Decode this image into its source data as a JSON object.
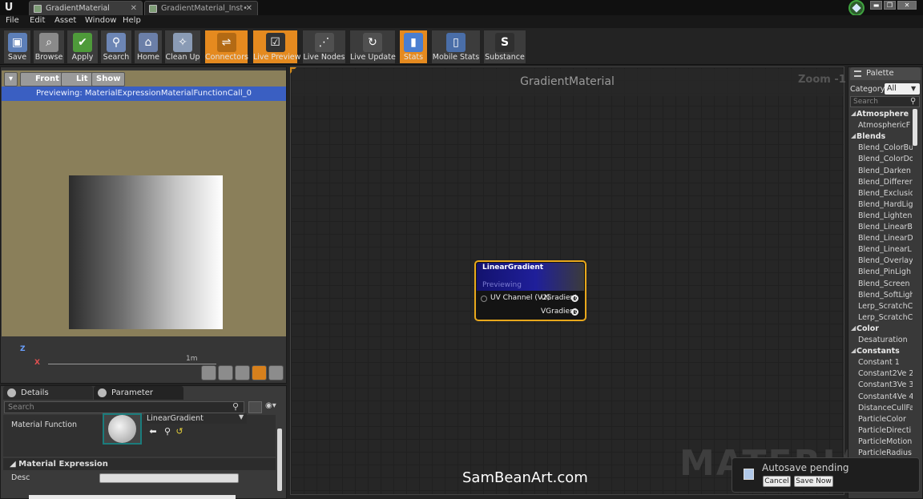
{
  "tabs": [
    {
      "label": "GradientMaterial",
      "close": "✕"
    },
    {
      "label": "GradientMaterial_Inst•",
      "close": "✕"
    }
  ],
  "window": {
    "minimize": "▬",
    "maximize": "❐",
    "close": "✕"
  },
  "menu": [
    "File",
    "Edit",
    "Asset",
    "Window",
    "Help"
  ],
  "toolbar": [
    {
      "label": "Save",
      "icon": "save-icon",
      "glyph": "▣"
    },
    {
      "label": "Browse",
      "icon": "browse-icon",
      "glyph": "⌕"
    },
    {
      "label": "Apply",
      "icon": "apply-icon",
      "glyph": "✔"
    },
    {
      "label": "Search",
      "icon": "search-icon",
      "glyph": "⚲"
    },
    {
      "label": "Home",
      "icon": "home-icon",
      "glyph": "⌂"
    },
    {
      "label": "Clean Up",
      "icon": "cleanup-icon",
      "glyph": "✧"
    },
    {
      "label": "Connectors",
      "icon": "connectors-icon",
      "glyph": "⇌"
    },
    {
      "label": "Live Preview",
      "icon": "live-preview-icon",
      "glyph": "☑"
    },
    {
      "label": "Live Nodes",
      "icon": "live-nodes-icon",
      "glyph": "⋰"
    },
    {
      "label": "Live Update",
      "icon": "live-update-icon",
      "glyph": "↻"
    },
    {
      "label": "Stats",
      "icon": "stats-icon",
      "glyph": "▮"
    },
    {
      "label": "Mobile Stats",
      "icon": "mobile-stats-icon",
      "glyph": "▯"
    },
    {
      "label": "Substance",
      "icon": "substance-icon",
      "glyph": "S"
    }
  ],
  "viewport": {
    "buttons": {
      "dropdown": "▾",
      "front": "Front",
      "lit": "Lit",
      "show": "Show"
    },
    "previewing": "Previewing: MaterialExpressionMaterialFunctionCall_0",
    "axis_z": "Z",
    "axis_x": "X",
    "scale": "1m"
  },
  "details": {
    "tabs": [
      "Details",
      "Parameter Defaults"
    ],
    "search_placeholder": "Search",
    "material_function_label": "Material Function",
    "material_function_value": "LinearGradient",
    "section": "Material Expression",
    "desc_label": "Desc"
  },
  "graph": {
    "title": "GradientMaterial",
    "zoom": "Zoom -1",
    "watermark": "MATERIAL",
    "node": {
      "title": "LinearGradient",
      "subtitle": "Previewing",
      "input": "UV Channel (V2)",
      "outputs": [
        "UGradient",
        "VGradient"
      ]
    }
  },
  "palette": {
    "tab": "Palette",
    "category_label": "Category:",
    "category_value": "All",
    "search_placeholder": "Search",
    "rows": [
      {
        "text": "Atmosphere",
        "cat": true
      },
      {
        "text": "AtmosphericF",
        "cat": false
      },
      {
        "text": "Blends",
        "cat": true
      },
      {
        "text": "Blend_ColorBu",
        "cat": false
      },
      {
        "text": "Blend_ColorDo",
        "cat": false
      },
      {
        "text": "Blend_Darken",
        "cat": false
      },
      {
        "text": "Blend_Differer",
        "cat": false
      },
      {
        "text": "Blend_Exclusio",
        "cat": false
      },
      {
        "text": "Blend_HardLig",
        "cat": false
      },
      {
        "text": "Blend_Lighten",
        "cat": false
      },
      {
        "text": "Blend_LinearB",
        "cat": false
      },
      {
        "text": "Blend_LinearD",
        "cat": false
      },
      {
        "text": "Blend_LinearL",
        "cat": false
      },
      {
        "text": "Blend_Overlay",
        "cat": false
      },
      {
        "text": "Blend_PinLigh",
        "cat": false
      },
      {
        "text": "Blend_Screen",
        "cat": false
      },
      {
        "text": "Blend_SoftLigh",
        "cat": false
      },
      {
        "text": "Lerp_ScratchC",
        "cat": false
      },
      {
        "text": "Lerp_ScratchC",
        "cat": false
      },
      {
        "text": "Color",
        "cat": true
      },
      {
        "text": "Desaturation",
        "cat": false
      },
      {
        "text": "Constants",
        "cat": true
      },
      {
        "text": "Constant    1",
        "cat": false
      },
      {
        "text": "Constant2Ve 2",
        "cat": false
      },
      {
        "text": "Constant3Ve 3",
        "cat": false
      },
      {
        "text": "Constant4Ve 4",
        "cat": false
      },
      {
        "text": "DistanceCullFa",
        "cat": false
      },
      {
        "text": "ParticleColor",
        "cat": false
      },
      {
        "text": "ParticleDirecti",
        "cat": false
      },
      {
        "text": "ParticleMotion",
        "cat": false
      },
      {
        "text": "ParticleRadius",
        "cat": false
      }
    ]
  },
  "overlay": {
    "watermark": "SamBeanArt.com",
    "autosave": "Autosave pending",
    "cancel": "Cancel",
    "save_now": "Save Now"
  },
  "colors": {
    "accent": "#e58a1f",
    "node_border": "#e8a81c",
    "preview_bar": "#3a5fc2"
  }
}
